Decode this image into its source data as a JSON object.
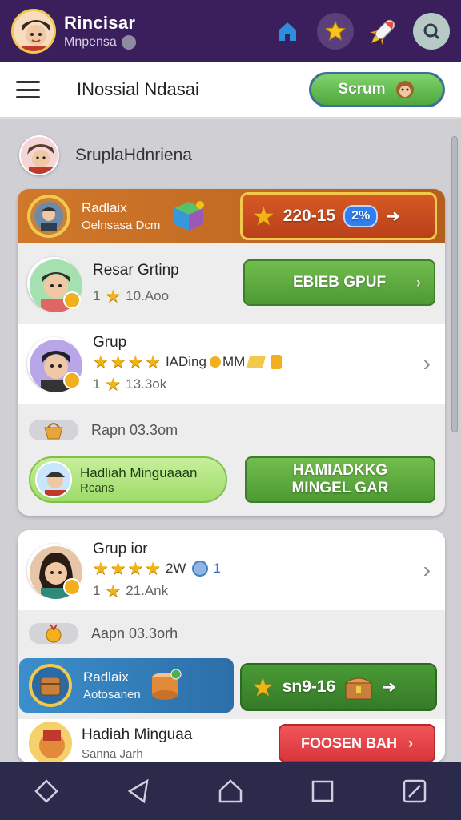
{
  "topbar": {
    "title": "Rincisar",
    "subtitle": "Mnpensa",
    "colors": {
      "background": "#3a1f5c",
      "accent": "#f2c94c"
    },
    "icons": [
      "home-icon",
      "star-icon",
      "rocket-icon",
      "search-icon"
    ]
  },
  "header": {
    "title": "INossial Ndasai",
    "button_label": "Scrum"
  },
  "section": {
    "title": "SruplaHdnriena"
  },
  "card1": {
    "reward": {
      "title": "Radlaix",
      "subtitle": "Oelnsasa Dcm",
      "value": "220-15",
      "badge": "2%"
    },
    "group1": {
      "title": "Resar Grtinp",
      "meta_count": "1",
      "meta_time": "10.Aoo",
      "button_label": "EBIEB GPUF"
    },
    "group2": {
      "title": "Grup",
      "stars_text": "IADing",
      "extra": "MM",
      "meta_count": "1",
      "meta_time": "13.3ok"
    },
    "mini_text": "Rapn 03.3om",
    "hadiah": {
      "title": "Hadliah Minguaaan",
      "subtitle": "Rcans"
    },
    "big_button_label": "HAMIADKKG MINGEL GAR"
  },
  "card2": {
    "group": {
      "title": "Grup ior",
      "stars_text": "2W",
      "extra": "1",
      "meta_count": "1",
      "meta_time": "21.Ank"
    },
    "mini_text": "Aapn 03.3orh",
    "reward": {
      "title": "Radlaix",
      "subtitle": "Aotosanen",
      "value": "sn9-16"
    },
    "hadiah": {
      "title": "Hadiah Minguaa",
      "subtitle": "Sanna Jarh"
    },
    "red_button_label": "FOOSEN BAH"
  },
  "bottom_nav": [
    "back-icon",
    "send-icon",
    "home-icon",
    "square-icon",
    "edit-icon"
  ]
}
